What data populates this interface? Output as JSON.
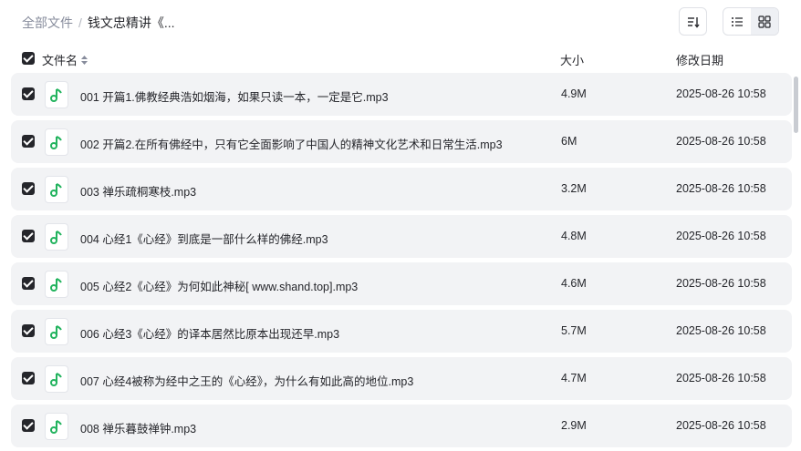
{
  "breadcrumb": {
    "root": "全部文件",
    "separator": "/",
    "current": "钱文忠精讲《..."
  },
  "toolbar": {
    "sort_icon": "sort-icon",
    "list_view_icon": "list-view-icon",
    "grid_view_icon": "grid-view-icon",
    "active_view": "list"
  },
  "table": {
    "columns": {
      "name": "文件名",
      "size": "大小",
      "date": "修改日期"
    },
    "rows": [
      {
        "name": "001 开篇1.佛教经典浩如烟海，如果只读一本，一定是它.mp3",
        "size": "4.9M",
        "date": "2025-08-26 10:58",
        "checked": true
      },
      {
        "name": "002 开篇2.在所有佛经中，只有它全面影响了中国人的精神文化艺术和日常生活.mp3",
        "size": "6M",
        "date": "2025-08-26 10:58",
        "checked": true
      },
      {
        "name": "003 禅乐疏桐寒枝.mp3",
        "size": "3.2M",
        "date": "2025-08-26 10:58",
        "checked": true
      },
      {
        "name": "004 心经1《心经》到底是一部什么样的佛经.mp3",
        "size": "4.8M",
        "date": "2025-08-26 10:58",
        "checked": true
      },
      {
        "name": "005 心经2《心经》为何如此神秘[ www.shand.top].mp3",
        "size": "4.6M",
        "date": "2025-08-26 10:58",
        "checked": true
      },
      {
        "name": "006 心经3《心经》的译本居然比原本出现还早.mp3",
        "size": "5.7M",
        "date": "2025-08-26 10:58",
        "checked": true
      },
      {
        "name": "007 心经4被称为经中之王的《心经》，为什么有如此高的地位.mp3",
        "size": "4.7M",
        "date": "2025-08-26 10:58",
        "checked": true
      },
      {
        "name": "008 禅乐暮鼓禅钟.mp3",
        "size": "2.9M",
        "date": "2025-08-26 10:58",
        "checked": true
      }
    ]
  },
  "colors": {
    "accent_green": "#22b35e",
    "row_bg": "#f2f3f5",
    "text": "#25262b",
    "muted": "#878c9c"
  }
}
